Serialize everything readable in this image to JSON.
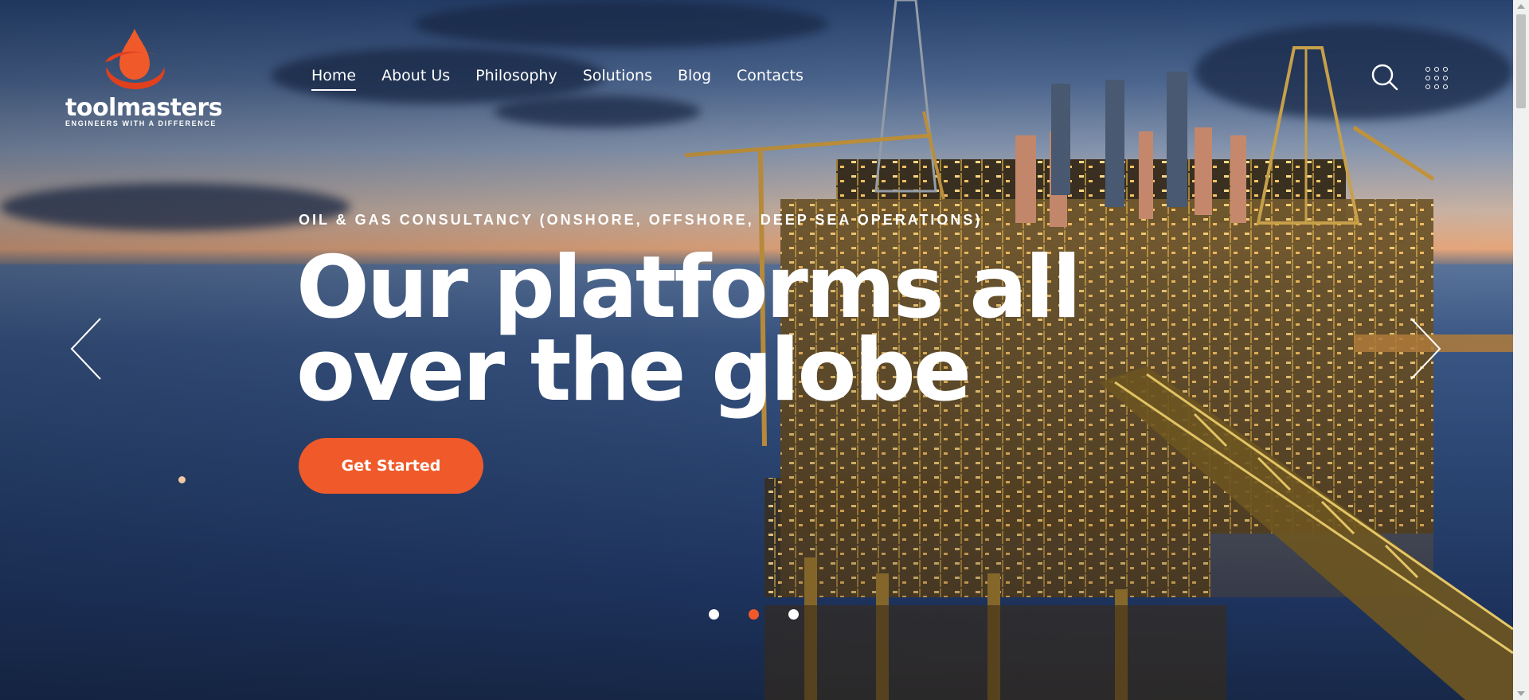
{
  "brand": {
    "name": "toolmasters",
    "tagline": "ENGINEERS WITH A DIFFERENCE",
    "accent_color": "#f05a2a"
  },
  "nav": {
    "items": [
      {
        "label": "Home",
        "active": true
      },
      {
        "label": "About Us",
        "active": false
      },
      {
        "label": "Philosophy",
        "active": false
      },
      {
        "label": "Solutions",
        "active": false
      },
      {
        "label": "Blog",
        "active": false
      },
      {
        "label": "Contacts",
        "active": false
      }
    ]
  },
  "header_actions": {
    "search_icon": "search-icon",
    "menu_icon": "grid-menu-icon"
  },
  "hero": {
    "eyebrow": "OIL & GAS CONSULTANCY (ONSHORE, OFFSHORE, DEEP SEA OPERATIONS)",
    "headline_line1": "Our platforms all",
    "headline_line2": "over the globe",
    "cta_label": "Get Started",
    "prev_icon": "chevron-left-icon",
    "next_icon": "chevron-right-icon"
  },
  "slider": {
    "slide_count": 3,
    "active_index": 1
  }
}
